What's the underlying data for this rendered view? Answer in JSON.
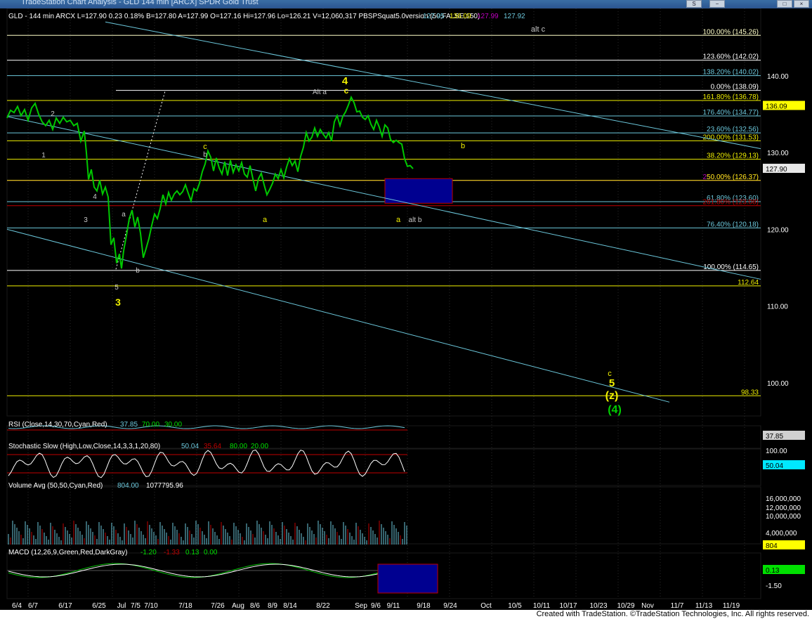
{
  "window": {
    "title": "TradeStation Chart Analysis - GLD 144 min [ARCX] SPDR Gold Trust",
    "buttons": [
      "S",
      "−",
      "□",
      "×"
    ]
  },
  "footer": {
    "credit": "Created with TradeStation. ©TradeStation Technologies, Inc. All rights reserved."
  },
  "colors": {
    "price": "#00c800",
    "cyan": "#6cc8dc",
    "yellow": "#f0f000",
    "magenta": "#c000c0",
    "red": "#c00000",
    "box": "#000090"
  },
  "chart_data": [
    {
      "type": "line",
      "title": "GLD - 144 min  ARCX  L=127.90  0.23  0.18%  B=127.80  A=127.99  O=127.16  Hi=127.96  Lo=126.21  V=12,060,317  PBSPSquat5.0version (50,FALSE,150)",
      "header_values": [
        "127.95",
        "136.09",
        "127.99",
        "127.92"
      ],
      "ylim": [
        95,
        148
      ],
      "y_ticks": [
        100,
        110,
        120,
        130,
        140
      ],
      "x_ticks": [
        "6/4",
        "6/7",
        "6/17",
        "6/25",
        "Jul",
        "7/5",
        "7/10",
        "7/18",
        "7/26",
        "Aug",
        "8/6",
        "8/9",
        "8/14",
        "8/22",
        "Sep",
        "9/6",
        "9/11",
        "9/18",
        "9/24",
        "Oct",
        "10/5",
        "10/11",
        "10/17",
        "10/23",
        "10/29",
        "Nov",
        "11/7",
        "11/13",
        "11/19"
      ],
      "price_path": [
        [
          0,
          134.5
        ],
        [
          5,
          135.5
        ],
        [
          10,
          135.2
        ],
        [
          15,
          136.0
        ],
        [
          20,
          134.8
        ],
        [
          25,
          135.6
        ],
        [
          30,
          134.2
        ],
        [
          35,
          135.8
        ],
        [
          40,
          136.4
        ],
        [
          45,
          135.0
        ],
        [
          50,
          134.0
        ],
        [
          55,
          133.5
        ],
        [
          60,
          134.2
        ],
        [
          65,
          133.0
        ],
        [
          70,
          134.5
        ],
        [
          75,
          133.8
        ],
        [
          80,
          134.6
        ],
        [
          85,
          134.0
        ],
        [
          90,
          134.2
        ],
        [
          95,
          133.5
        ],
        [
          100,
          133.8
        ],
        [
          105,
          131.5
        ],
        [
          110,
          132.8
        ],
        [
          113,
          130.0
        ],
        [
          116,
          126.5
        ],
        [
          120,
          127.8
        ],
        [
          124,
          125.5
        ],
        [
          128,
          125.0
        ],
        [
          132,
          126.4
        ],
        [
          136,
          124.6
        ],
        [
          140,
          125.5
        ],
        [
          144,
          124.2
        ],
        [
          148,
          118.0
        ],
        [
          152,
          118.9
        ],
        [
          156,
          115.6
        ],
        [
          160,
          116.8
        ],
        [
          163,
          114.9
        ],
        [
          166,
          117.2
        ],
        [
          170,
          119.2
        ],
        [
          174,
          121.4
        ],
        [
          178,
          122.5
        ],
        [
          182,
          120.3
        ],
        [
          186,
          121.6
        ],
        [
          190,
          119.5
        ],
        [
          194,
          116.3
        ],
        [
          198,
          117.5
        ],
        [
          202,
          118.8
        ],
        [
          206,
          120.5
        ],
        [
          210,
          122.0
        ],
        [
          214,
          121.4
        ],
        [
          218,
          122.7
        ],
        [
          222,
          124.5
        ],
        [
          226,
          123.3
        ],
        [
          230,
          124.8
        ],
        [
          234,
          123.8
        ],
        [
          238,
          124.6
        ],
        [
          242,
          125.0
        ],
        [
          246,
          124.5
        ],
        [
          250,
          124.9
        ],
        [
          254,
          125.8
        ],
        [
          258,
          124.7
        ],
        [
          262,
          123.7
        ],
        [
          266,
          125.3
        ],
        [
          270,
          125.0
        ],
        [
          274,
          126.0
        ],
        [
          278,
          127.5
        ],
        [
          282,
          128.5
        ],
        [
          286,
          130.2
        ],
        [
          290,
          129.4
        ],
        [
          294,
          127.6
        ],
        [
          298,
          129.3
        ],
        [
          302,
          128.0
        ],
        [
          306,
          127.2
        ],
        [
          310,
          128.8
        ],
        [
          314,
          127.0
        ],
        [
          318,
          129.0
        ],
        [
          322,
          127.4
        ],
        [
          326,
          128.4
        ],
        [
          330,
          127.6
        ],
        [
          334,
          128.7
        ],
        [
          338,
          127.2
        ],
        [
          342,
          126.8
        ],
        [
          346,
          128.3
        ],
        [
          350,
          126.6
        ],
        [
          354,
          125.0
        ],
        [
          358,
          126.6
        ],
        [
          362,
          127.3
        ],
        [
          366,
          125.8
        ],
        [
          370,
          124.5
        ],
        [
          374,
          125.2
        ],
        [
          378,
          126.0
        ],
        [
          382,
          127.2
        ],
        [
          386,
          126.6
        ],
        [
          390,
          127.8
        ],
        [
          394,
          126.7
        ],
        [
          398,
          128.1
        ],
        [
          402,
          129.2
        ],
        [
          406,
          128.3
        ],
        [
          410,
          128.9
        ],
        [
          414,
          127.5
        ],
        [
          418,
          129.5
        ],
        [
          422,
          130.7
        ],
        [
          426,
          132.6
        ],
        [
          430,
          131.5
        ],
        [
          434,
          132.0
        ],
        [
          438,
          133.2
        ],
        [
          442,
          132.1
        ],
        [
          446,
          133.0
        ],
        [
          450,
          132.4
        ],
        [
          454,
          131.9
        ],
        [
          458,
          132.6
        ],
        [
          462,
          131.5
        ],
        [
          466,
          134.0
        ],
        [
          470,
          134.8
        ],
        [
          474,
          133.5
        ],
        [
          478,
          134.7
        ],
        [
          482,
          135.3
        ],
        [
          486,
          136.2
        ],
        [
          490,
          137.2
        ],
        [
          494,
          136.5
        ],
        [
          498,
          135.3
        ],
        [
          502,
          135.4
        ],
        [
          506,
          134.6
        ],
        [
          510,
          134.3
        ],
        [
          514,
          134.8
        ],
        [
          518,
          133.7
        ],
        [
          522,
          133.0
        ],
        [
          526,
          134.2
        ],
        [
          530,
          133.3
        ],
        [
          534,
          132.1
        ],
        [
          538,
          133.6
        ],
        [
          542,
          133.2
        ],
        [
          546,
          131.7
        ],
        [
          550,
          131.3
        ],
        [
          554,
          131.6
        ],
        [
          558,
          131.3
        ],
        [
          562,
          131.1
        ],
        [
          566,
          129.2
        ],
        [
          570,
          128.2
        ],
        [
          574,
          128.3
        ],
        [
          578,
          127.9
        ]
      ],
      "annotations": [
        "1",
        "2",
        "3",
        "4",
        "5",
        "3",
        "a",
        "b",
        "c",
        "a",
        "b",
        "c",
        "4",
        "Alt a",
        "b",
        "a",
        "alt b",
        "alt c",
        "c",
        "5",
        "(z)",
        "(4)"
      ],
      "fib_levels": [
        {
          "label": "100.00% (145.26)",
          "value": 145.26
        },
        {
          "label": "123.60% (142.02)",
          "value": 142.02
        },
        {
          "label": "138.20% (140.02)",
          "value": 140.02
        },
        {
          "label": "0.00% (138.09)",
          "value": 138.09
        },
        {
          "label": "161.80% (136.78)",
          "value": 136.78
        },
        {
          "label": "176.40% (134.77)",
          "value": 134.77
        },
        {
          "label": "23.60% (132.56)",
          "value": 132.56
        },
        {
          "label": "200.00% (131.53)",
          "value": 131.53
        },
        {
          "label": "38.20% (129.13)",
          "value": 129.13
        },
        {
          "label": "250.00% (126.37)",
          "value": 126.37
        },
        {
          "label": "50.00% (126.37)",
          "value": 126.37
        },
        {
          "label": "61.80% (123.60)",
          "value": 123.6
        },
        {
          "label": "261.80% (123.08)",
          "value": 123.08
        },
        {
          "label": "76.40% (120.18)",
          "value": 120.18
        },
        {
          "label": "100.00% (114.65)",
          "value": 114.65
        },
        {
          "label": "112.64",
          "value": 112.64
        },
        {
          "label": "98.33",
          "value": 98.33
        }
      ],
      "price_badges": [
        {
          "text": "136.09",
          "value": 136.09
        },
        {
          "text": "127.90",
          "value": 127.9
        }
      ]
    },
    {
      "type": "line",
      "title": "RSI (Close,14,30,70,Cyan,Red)",
      "header_values": [
        "37.85",
        "70.00",
        "30.00"
      ],
      "last": "37.85"
    },
    {
      "type": "line",
      "title": "Stochastic Slow (High,Low,Close,14,3,3,1,20,80)",
      "header_values": [
        "50.04",
        "35.64",
        "80.00",
        "20.00"
      ],
      "y_ticks": [
        "100.00"
      ],
      "last": "50.04"
    },
    {
      "type": "bar",
      "title": "Volume Avg (50,50,Cyan,Red)",
      "header_values": [
        "804.00",
        "1077795.96"
      ],
      "y_ticks": [
        "16,000,000",
        "12,000,000",
        "10,000,000",
        "4,000,000"
      ],
      "last": "804"
    },
    {
      "type": "line",
      "title": "MACD (12,26,9,Green,Red,DarkGray)",
      "header_values": [
        "-1.20",
        "-1.33",
        "0.13",
        "0.00"
      ],
      "y_ticks": [
        "-1.50"
      ],
      "last": "0.13"
    }
  ]
}
